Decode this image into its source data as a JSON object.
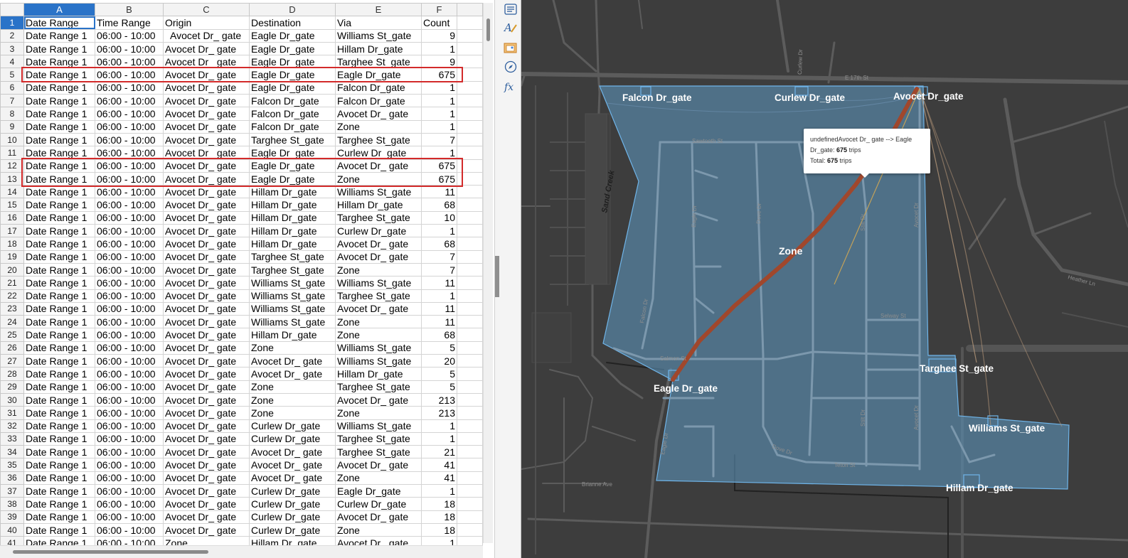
{
  "sheet": {
    "column_headers": [
      "A",
      "B",
      "C",
      "D",
      "E",
      "F"
    ],
    "active_column": "A",
    "active_row": 1,
    "highlighted_rows": [
      [
        5
      ],
      [
        12,
        13
      ]
    ],
    "rows": [
      {
        "n": "1",
        "cells": [
          "Date Range",
          "Time Range",
          "Origin",
          "Destination",
          "Via",
          "Count"
        ]
      },
      {
        "n": "2",
        "cells": [
          "Date Range 1",
          "06:00 - 10:00",
          "  Avocet Dr_ gate",
          "Eagle Dr_gate",
          "Williams St_gate",
          "9"
        ]
      },
      {
        "n": "3",
        "cells": [
          "Date Range 1",
          "06:00 - 10:00",
          "Avocet Dr_ gate",
          "Eagle Dr_gate",
          "Hillam Dr_gate",
          "1"
        ]
      },
      {
        "n": "4",
        "cells": [
          "Date Range 1",
          "06:00 - 10:00",
          "Avocet Dr_ gate",
          "Eagle Dr_gate",
          "Targhee St_gate",
          "9"
        ]
      },
      {
        "n": "5",
        "cells": [
          "Date Range 1",
          "06:00 - 10:00",
          "Avocet Dr_ gate",
          "Eagle Dr_gate",
          "Eagle Dr_gate",
          "675"
        ]
      },
      {
        "n": "6",
        "cells": [
          "Date Range 1",
          "06:00 - 10:00",
          "Avocet Dr_ gate",
          "Eagle Dr_gate",
          "Falcon Dr_gate",
          "1"
        ]
      },
      {
        "n": "7",
        "cells": [
          "Date Range 1",
          "06:00 - 10:00",
          "Avocet Dr_ gate",
          "Falcon Dr_gate",
          "Falcon Dr_gate",
          "1"
        ]
      },
      {
        "n": "8",
        "cells": [
          "Date Range 1",
          "06:00 - 10:00",
          "Avocet Dr_ gate",
          "Falcon Dr_gate",
          "Avocet Dr_ gate",
          "1"
        ]
      },
      {
        "n": "9",
        "cells": [
          "Date Range 1",
          "06:00 - 10:00",
          "Avocet Dr_ gate",
          "Falcon Dr_gate",
          "Zone",
          "1"
        ]
      },
      {
        "n": "10",
        "cells": [
          "Date Range 1",
          "06:00 - 10:00",
          "Avocet Dr_ gate",
          "Targhee St_gate",
          "Targhee St_gate",
          "7"
        ]
      },
      {
        "n": "11",
        "cells": [
          "Date Range 1",
          "06:00 - 10:00",
          "Avocet Dr_ gate",
          "Eagle Dr_gate",
          "Curlew Dr_gate",
          "1"
        ]
      },
      {
        "n": "12",
        "cells": [
          "Date Range 1",
          "06:00 - 10:00",
          "Avocet Dr_ gate",
          "Eagle Dr_gate",
          "Avocet Dr_ gate",
          "675"
        ]
      },
      {
        "n": "13",
        "cells": [
          "Date Range 1",
          "06:00 - 10:00",
          "Avocet Dr_ gate",
          "Eagle Dr_gate",
          "Zone",
          "675"
        ]
      },
      {
        "n": "14",
        "cells": [
          "Date Range 1",
          "06:00 - 10:00",
          "Avocet Dr_ gate",
          "Hillam Dr_gate",
          "Williams St_gate",
          "11"
        ]
      },
      {
        "n": "15",
        "cells": [
          "Date Range 1",
          "06:00 - 10:00",
          "Avocet Dr_ gate",
          "Hillam Dr_gate",
          "Hillam Dr_gate",
          "68"
        ]
      },
      {
        "n": "16",
        "cells": [
          "Date Range 1",
          "06:00 - 10:00",
          "Avocet Dr_ gate",
          "Hillam Dr_gate",
          "Targhee St_gate",
          "10"
        ]
      },
      {
        "n": "17",
        "cells": [
          "Date Range 1",
          "06:00 - 10:00",
          "Avocet Dr_ gate",
          "Hillam Dr_gate",
          "Curlew Dr_gate",
          "1"
        ]
      },
      {
        "n": "18",
        "cells": [
          "Date Range 1",
          "06:00 - 10:00",
          "Avocet Dr_ gate",
          "Hillam Dr_gate",
          "Avocet Dr_ gate",
          "68"
        ]
      },
      {
        "n": "19",
        "cells": [
          "Date Range 1",
          "06:00 - 10:00",
          "Avocet Dr_ gate",
          "Targhee St_gate",
          "Avocet Dr_ gate",
          "7"
        ]
      },
      {
        "n": "20",
        "cells": [
          "Date Range 1",
          "06:00 - 10:00",
          "Avocet Dr_ gate",
          "Targhee St_gate",
          "Zone",
          "7"
        ]
      },
      {
        "n": "21",
        "cells": [
          "Date Range 1",
          "06:00 - 10:00",
          "Avocet Dr_ gate",
          "Williams St_gate",
          "Williams St_gate",
          "11"
        ]
      },
      {
        "n": "22",
        "cells": [
          "Date Range 1",
          "06:00 - 10:00",
          "Avocet Dr_ gate",
          "Williams St_gate",
          "Targhee St_gate",
          "1"
        ]
      },
      {
        "n": "23",
        "cells": [
          "Date Range 1",
          "06:00 - 10:00",
          "Avocet Dr_ gate",
          "Williams St_gate",
          "Avocet Dr_ gate",
          "11"
        ]
      },
      {
        "n": "24",
        "cells": [
          "Date Range 1",
          "06:00 - 10:00",
          "Avocet Dr_ gate",
          "Williams St_gate",
          "Zone",
          "11"
        ]
      },
      {
        "n": "25",
        "cells": [
          "Date Range 1",
          "06:00 - 10:00",
          "Avocet Dr_ gate",
          "Hillam Dr_gate",
          "Zone",
          "68"
        ]
      },
      {
        "n": "26",
        "cells": [
          "Date Range 1",
          "06:00 - 10:00",
          "Avocet Dr_ gate",
          "Zone",
          "Williams St_gate",
          "5"
        ]
      },
      {
        "n": "27",
        "cells": [
          "Date Range 1",
          "06:00 - 10:00",
          "Avocet Dr_ gate",
          "Avocet Dr_ gate",
          "Williams St_gate",
          "20"
        ]
      },
      {
        "n": "28",
        "cells": [
          "Date Range 1",
          "06:00 - 10:00",
          "Avocet Dr_ gate",
          "Avocet Dr_ gate",
          "Hillam Dr_gate",
          "5"
        ]
      },
      {
        "n": "29",
        "cells": [
          "Date Range 1",
          "06:00 - 10:00",
          "Avocet Dr_ gate",
          "Zone",
          "Targhee St_gate",
          "5"
        ]
      },
      {
        "n": "30",
        "cells": [
          "Date Range 1",
          "06:00 - 10:00",
          "Avocet Dr_ gate",
          "Zone",
          "Avocet Dr_ gate",
          "213"
        ]
      },
      {
        "n": "31",
        "cells": [
          "Date Range 1",
          "06:00 - 10:00",
          "Avocet Dr_ gate",
          "Zone",
          "Zone",
          "213"
        ]
      },
      {
        "n": "32",
        "cells": [
          "Date Range 1",
          "06:00 - 10:00",
          "Avocet Dr_ gate",
          "Curlew Dr_gate",
          "Williams St_gate",
          "1"
        ]
      },
      {
        "n": "33",
        "cells": [
          "Date Range 1",
          "06:00 - 10:00",
          "Avocet Dr_ gate",
          "Curlew Dr_gate",
          "Targhee St_gate",
          "1"
        ]
      },
      {
        "n": "34",
        "cells": [
          "Date Range 1",
          "06:00 - 10:00",
          "Avocet Dr_ gate",
          "Avocet Dr_ gate",
          "Targhee St_gate",
          "21"
        ]
      },
      {
        "n": "35",
        "cells": [
          "Date Range 1",
          "06:00 - 10:00",
          "Avocet Dr_ gate",
          "Avocet Dr_ gate",
          "Avocet Dr_ gate",
          "41"
        ]
      },
      {
        "n": "36",
        "cells": [
          "Date Range 1",
          "06:00 - 10:00",
          "Avocet Dr_ gate",
          "Avocet Dr_ gate",
          "Zone",
          "41"
        ]
      },
      {
        "n": "37",
        "cells": [
          "Date Range 1",
          "06:00 - 10:00",
          "Avocet Dr_ gate",
          "Curlew Dr_gate",
          "Eagle Dr_gate",
          "1"
        ]
      },
      {
        "n": "38",
        "cells": [
          "Date Range 1",
          "06:00 - 10:00",
          "Avocet Dr_ gate",
          "Curlew Dr_gate",
          "Curlew Dr_gate",
          "18"
        ]
      },
      {
        "n": "39",
        "cells": [
          "Date Range 1",
          "06:00 - 10:00",
          "Avocet Dr_ gate",
          "Curlew Dr_gate",
          "Avocet Dr_ gate",
          "18"
        ]
      },
      {
        "n": "40",
        "cells": [
          "Date Range 1",
          "06:00 - 10:00",
          "Avocet Dr_ gate",
          "Curlew Dr_gate",
          "Zone",
          "18"
        ]
      },
      {
        "n": "41",
        "cells": [
          "Date Range 1",
          "06:00 - 10:00",
          "Zone",
          "Hillam Dr_gate",
          "Avocet Dr_ gate",
          "1"
        ]
      }
    ]
  },
  "sidebar": {
    "tools": [
      {
        "name": "properties-icon",
        "glyph": "☰"
      },
      {
        "name": "styles-icon",
        "glyph": "A"
      },
      {
        "name": "gallery-icon",
        "glyph": "▣"
      },
      {
        "name": "navigator-icon",
        "glyph": "◎"
      },
      {
        "name": "functions-icon",
        "glyph": "fx"
      }
    ]
  },
  "map": {
    "colors": {
      "background": "#3d3d3d",
      "zone_fill": "#5b8fb5",
      "zone_stroke": "#6fb4e8",
      "route": "#a0472c",
      "road": "#5a5a5a"
    },
    "zone_label": "Zone",
    "gates": [
      "Falcon Dr_gate",
      "Curlew Dr_gate",
      "Avocet Dr_gate",
      "Eagle Dr_gate",
      "Targhee St_gate",
      "Williams St_gate",
      "Hillam Dr_gate"
    ],
    "roads": [
      "E 17th St",
      "Sawtooth St",
      "Salmon St",
      "Selway St",
      "Teton St",
      "Brianne Ave",
      "Falcon Dr",
      "Eagle Dr",
      "Avocet Dr",
      "Curlew Dr",
      "Dove Dr",
      "Stilt Dr",
      "Heather Ln",
      "Sand Creek"
    ],
    "tooltip": {
      "line1": "undefinedAvocet Dr_ gate --> Eagle",
      "line2_prefix": "Dr_gate: ",
      "line2_value": "675",
      "line2_suffix": " trips",
      "line3_prefix": "Total: ",
      "line3_value": "675",
      "line3_suffix": " trips"
    }
  }
}
